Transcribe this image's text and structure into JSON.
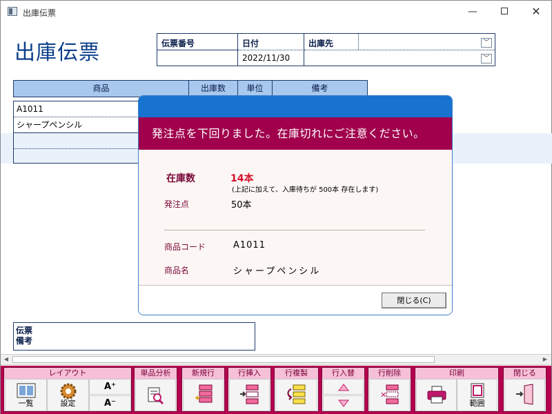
{
  "window": {
    "title": "出庫伝票",
    "min": "—",
    "close": "✕"
  },
  "page": {
    "heading": "出庫伝票"
  },
  "header": {
    "slip_no_label": "伝票番号",
    "date_label": "日付",
    "date_value": "2022/11/30",
    "dest_label": "出庫先"
  },
  "table": {
    "columns": [
      "商品",
      "出庫数",
      "単位",
      "備考"
    ],
    "rows": [
      {
        "product": "A1011"
      },
      {
        "product": "シャープペンシル"
      },
      {
        "product": ""
      },
      {
        "product": ""
      }
    ]
  },
  "memo": {
    "label": "伝票\n備考"
  },
  "toolbar": {
    "layout": {
      "title": "レイアウト",
      "list": "一覧",
      "settings": "設定",
      "font_up": "A⁺",
      "font_down": "A⁻"
    },
    "item_analysis": {
      "title": "単品分析"
    },
    "new_row": {
      "title": "新規行"
    },
    "insert_row": {
      "title": "行挿入"
    },
    "copy_row": {
      "title": "行複製"
    },
    "swap_row": {
      "title": "行入替"
    },
    "delete_row": {
      "title": "行削除"
    },
    "print": {
      "title": "印刷",
      "range": "範囲"
    },
    "close": {
      "title": "閉じる"
    }
  },
  "dialog": {
    "message": "発注点を下回りました。在庫切れにご注意ください。",
    "stock_label": "在庫数",
    "stock_value": "14本",
    "stock_note": "(上記に加えて、入庫待ちが 500本 存在します)",
    "reorder_label": "発注点",
    "reorder_value": "50本",
    "code_label": "商品コード",
    "code_value": "A1011",
    "name_label": "商品名",
    "name_value": "シャープペンシル",
    "close_button": "閉じる(C)"
  },
  "colors": {
    "accent": "#b5004f",
    "banner": "#a0004c",
    "dialog_top": "#1873d0",
    "heading": "#0a3f8a",
    "table_header": "#a8c8ee"
  }
}
